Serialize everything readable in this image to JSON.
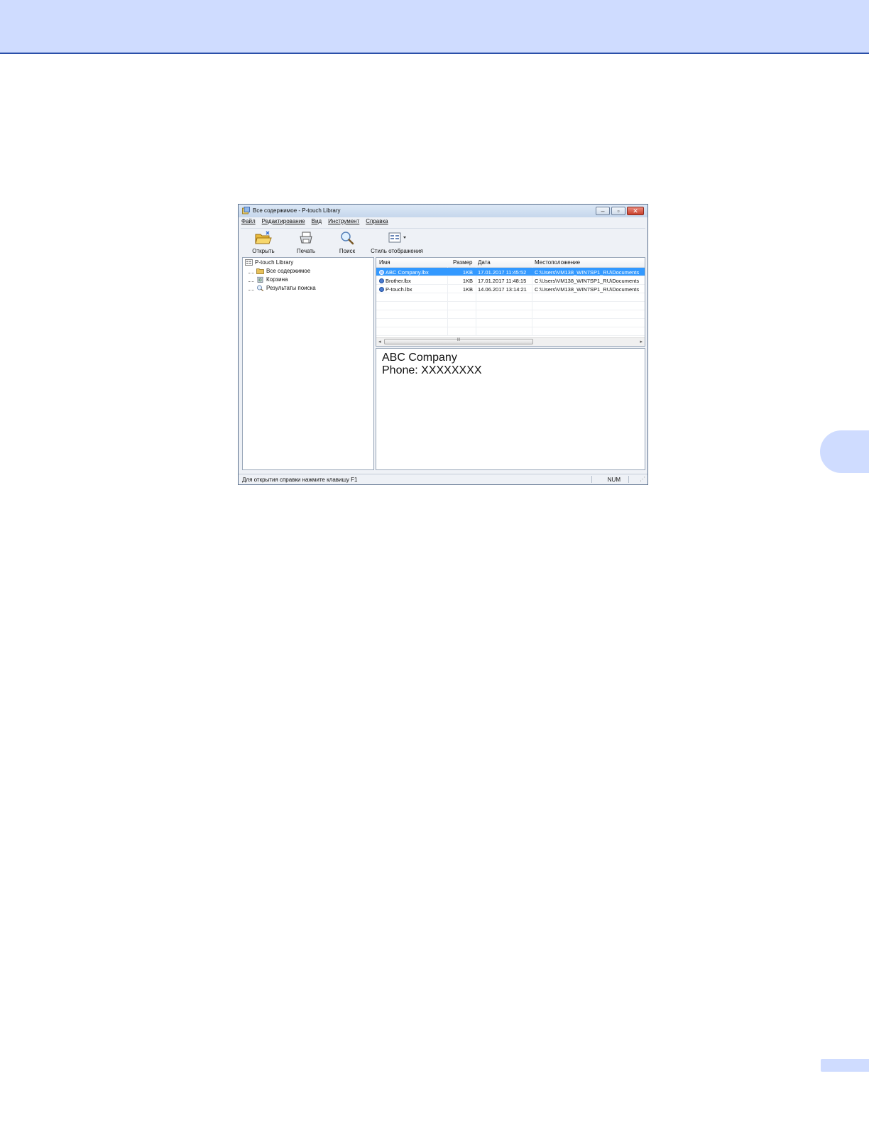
{
  "window": {
    "title": "Все содержимое - P-touch Library"
  },
  "menu": [
    "Файл",
    "Редактирование",
    "Вид",
    "Инструмент",
    "Справка"
  ],
  "toolbar": {
    "open": "Открыть",
    "print": "Печать",
    "search": "Поиск",
    "view_style": "Стиль отображения"
  },
  "tree": {
    "root": "P-touch Library",
    "items": [
      "Все содержимое",
      "Корзина",
      "Результаты поиска"
    ]
  },
  "list": {
    "columns": [
      "Имя",
      "Размер",
      "Дата",
      "Местоположение"
    ],
    "rows": [
      {
        "name": "ABC Company.lbx",
        "size": "1KB",
        "date": "17.01.2017 11:45:52",
        "location": "C:\\Users\\VM138_WIN7SP1_RU\\Documents",
        "selected": true
      },
      {
        "name": "Brother.lbx",
        "size": "1KB",
        "date": "17.01.2017 11:48:15",
        "location": "C:\\Users\\VM138_WIN7SP1_RU\\Documents",
        "selected": false
      },
      {
        "name": "P-touch.lbx",
        "size": "1KB",
        "date": "14.06.2017 13:14:21",
        "location": "C:\\Users\\VM138_WIN7SP1_RU\\Documents",
        "selected": false
      }
    ],
    "scroll_grip": "III"
  },
  "preview": {
    "line1": "ABC Company",
    "line2": "Phone: XXXXXXXX"
  },
  "status": {
    "text": "Для открытия справки нажмите клавишу F1",
    "num": "NUM"
  },
  "colors": {
    "page_accent": "#cfdcff",
    "header_rule": "#2a4fa8",
    "selection": "#3399ff"
  }
}
